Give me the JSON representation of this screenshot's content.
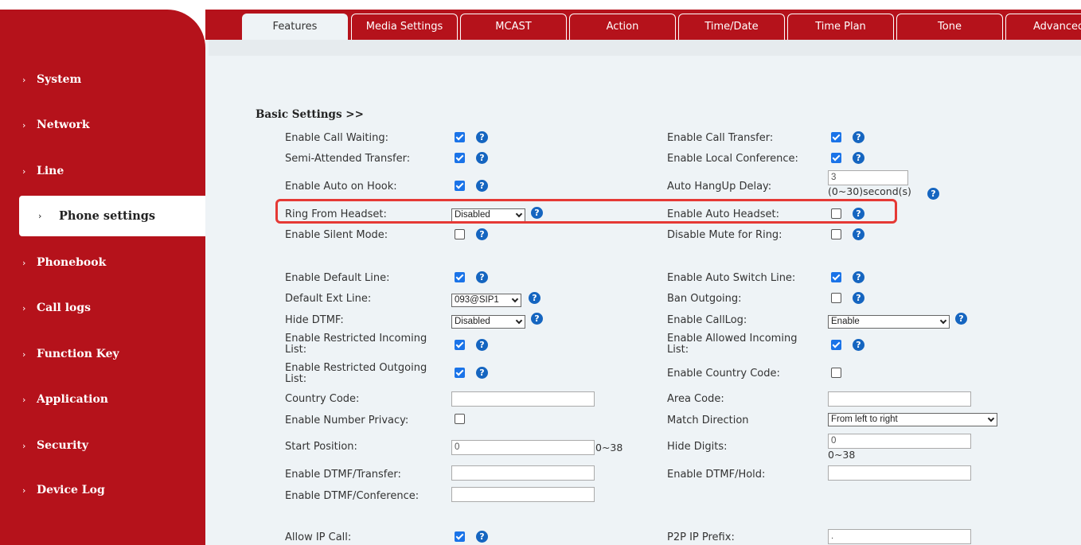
{
  "sidebar": {
    "items": [
      {
        "label": "System",
        "chevron": "›"
      },
      {
        "label": "Network",
        "chevron": "›"
      },
      {
        "label": "Line",
        "chevron": "›"
      },
      {
        "label": "Phone settings",
        "chevron": "›",
        "active": true
      },
      {
        "label": "Phonebook",
        "chevron": "›"
      },
      {
        "label": "Call logs",
        "chevron": "›"
      },
      {
        "label": "Function Key",
        "chevron": "›"
      },
      {
        "label": "Application",
        "chevron": "›"
      },
      {
        "label": "Security",
        "chevron": "›"
      },
      {
        "label": "Device Log",
        "chevron": "›"
      }
    ]
  },
  "tabs": [
    "Features",
    "Media Settings",
    "MCAST",
    "Action",
    "Time/Date",
    "Time Plan",
    "Tone",
    "Advanced"
  ],
  "section_title": "Basic Settings >>",
  "help_glyph": "?",
  "fields": {
    "call_waiting": {
      "label": "Enable Call Waiting:",
      "checked": true
    },
    "call_transfer": {
      "label": "Enable Call Transfer:",
      "checked": true
    },
    "semi_attended": {
      "label": "Semi-Attended Transfer:",
      "checked": true
    },
    "local_conference": {
      "label": "Enable Local Conference:",
      "checked": true
    },
    "auto_on_hook": {
      "label": "Enable Auto on Hook:",
      "checked": true
    },
    "auto_hangup_delay": {
      "label": "Auto HangUp Delay:",
      "value": "3",
      "hint": "(0~30)second(s)"
    },
    "ring_from_headset": {
      "label": "Ring From Headset:",
      "value": "Disabled"
    },
    "auto_headset": {
      "label": "Enable Auto Headset:",
      "checked": false
    },
    "silent_mode": {
      "label": "Enable Silent Mode:",
      "checked": false
    },
    "disable_mute_ring": {
      "label": "Disable Mute for Ring:",
      "checked": false
    },
    "default_line": {
      "label": "Enable Default Line:",
      "checked": true
    },
    "auto_switch_line": {
      "label": "Enable Auto Switch Line:",
      "checked": true
    },
    "default_ext_line": {
      "label": "Default Ext Line:",
      "value": "093@SIP1"
    },
    "ban_outgoing": {
      "label": "Ban Outgoing:",
      "checked": false
    },
    "hide_dtmf": {
      "label": "Hide DTMF:",
      "value": "Disabled"
    },
    "calllog": {
      "label": "Enable CallLog:",
      "value": "Enable"
    },
    "restricted_incoming": {
      "label": "Enable Restricted Incoming List:",
      "checked": true
    },
    "allowed_incoming": {
      "label": "Enable Allowed Incoming List:",
      "checked": true
    },
    "restricted_outgoing": {
      "label": "Enable Restricted Outgoing List:",
      "checked": true
    },
    "country_code_enable": {
      "label": "Enable Country Code:",
      "checked": false
    },
    "country_code": {
      "label": "Country Code:",
      "value": ""
    },
    "area_code": {
      "label": "Area Code:",
      "value": ""
    },
    "number_privacy": {
      "label": "Enable Number Privacy:",
      "checked": false
    },
    "match_direction": {
      "label": "Match Direction",
      "value": "From left to right"
    },
    "start_position": {
      "label": "Start Position:",
      "value": "0",
      "hint": "0~38"
    },
    "hide_digits": {
      "label": "Hide Digits:",
      "value": "0",
      "hint": "0~38"
    },
    "dtmf_transfer": {
      "label": "Enable DTMF/Transfer:",
      "value": ""
    },
    "dtmf_hold": {
      "label": "Enable DTMF/Hold:",
      "value": ""
    },
    "dtmf_conference": {
      "label": "Enable DTMF/Conference:",
      "value": ""
    },
    "allow_ip_call": {
      "label": "Allow IP Call:",
      "checked": true
    },
    "p2p_ip_prefix": {
      "label": "P2P IP Prefix:",
      "value": "."
    }
  }
}
